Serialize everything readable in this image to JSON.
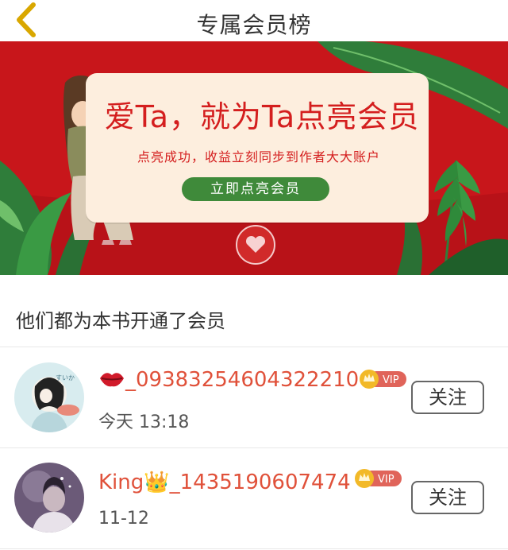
{
  "header": {
    "title": "专属会员榜"
  },
  "banner": {
    "headline": "爱Ta，就为Ta点亮会员",
    "subtitle": "点亮成功，收益立刻同步到作者大大账户",
    "button_label": "立即点亮会员"
  },
  "section": {
    "title": "他们都为本书开通了会员"
  },
  "members": [
    {
      "name": "_09383254604322210",
      "name_prefix_icon": "lips-icon",
      "time": "今天 13:18",
      "badge": "VIP",
      "follow_label": "关注"
    },
    {
      "name": "King👑_1435190607474",
      "time": "11-12",
      "badge": "VIP",
      "follow_label": "关注"
    }
  ],
  "colors": {
    "accent": "#e0513a",
    "banner_red": "#c8161b",
    "button_green": "#3f8a3a",
    "vip_pink": "#e0645a",
    "crown_gold": "#f2b928"
  }
}
